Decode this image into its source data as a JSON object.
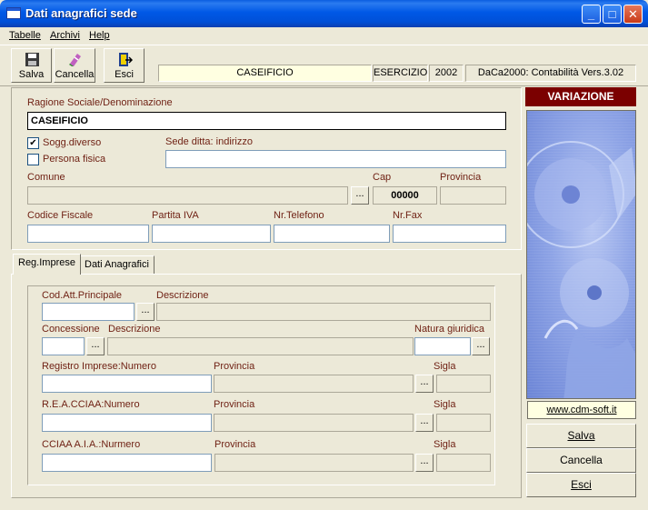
{
  "window": {
    "title": "Dati anagrafici sede"
  },
  "menu": {
    "tabelle": "Tabelle",
    "archivi": "Archivi",
    "help": "Help"
  },
  "toolbar": {
    "save_label": "Salva",
    "cancel_label": "Cancella",
    "exit_label": "Esci",
    "company": "CASEIFICIO",
    "esercizio_label": "ESERCIZIO",
    "year": "2002",
    "version": "DaCa2000: Contabilità Vers.3.02"
  },
  "form": {
    "ragione_label": "Ragione Sociale/Denominazione",
    "ragione_value": "CASEIFICIO",
    "sogg_diverso_label": "Sogg.diverso",
    "sogg_diverso_checked": true,
    "persona_fisica_label": "Persona fisica",
    "persona_fisica_checked": false,
    "sede_label": "Sede ditta: indirizzo",
    "comune_label": "Comune",
    "cap_label": "Cap",
    "cap_value": "00000",
    "provincia_label": "Provincia",
    "cf_label": "Codice Fiscale",
    "piva_label": "Partita IVA",
    "tel_label": "Nr.Telefono",
    "fax_label": "Nr.Fax",
    "dots": "..."
  },
  "tabs": [
    {
      "label": "Reg.Imprese",
      "active": true
    },
    {
      "label": "Dati Anagrafici",
      "active": false
    }
  ],
  "reg_imprese": {
    "cod_att_label": "Cod.Att.Principale",
    "descr_label": "Descrizione",
    "concessione_label": "Concessione",
    "natura_label": "Natura giuridica",
    "registro_label": "Registro Imprese:Numero",
    "provincia_label": "Provincia",
    "sigla_label": "Sigla",
    "rea_label": "R.E.A.CCIAA:Numero",
    "cciaa_label": "CCIAA A.I.A.:Nurmero"
  },
  "side": {
    "status": "VARIAZIONE",
    "website": "www.cdm-soft.it",
    "save_label": "Salva",
    "cancel_label": "Cancella",
    "exit_label": "Esci"
  },
  "colors": {
    "title_bar": "#0058e6",
    "status_banner": "#7b0000",
    "label": "#6e1f12",
    "logo_bg": "#8ea4e6"
  }
}
